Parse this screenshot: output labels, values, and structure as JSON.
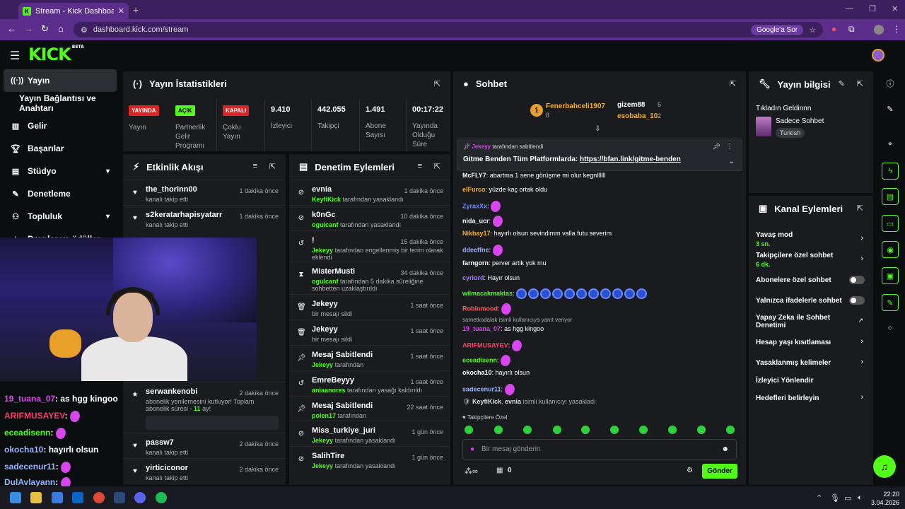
{
  "browser": {
    "tab_title": "Stream - Kick Dashboard",
    "url": "dashboard.kick.com/stream",
    "google_btn": "Google'a Sor"
  },
  "app": {
    "logo": "KICK",
    "logo_badge": "BETA"
  },
  "sidebar": {
    "items": [
      {
        "label": "Yayın",
        "icon": "broadcast-icon"
      },
      {
        "label": "Yayın Bağlantısı ve Anahtarı"
      },
      {
        "label": "Gelir",
        "icon": "chart-icon"
      },
      {
        "label": "Başarılar",
        "icon": "trophy-icon"
      },
      {
        "label": "Stüdyo",
        "icon": "studio-icon"
      },
      {
        "label": "Denetleme",
        "icon": "wrench-icon"
      },
      {
        "label": "Topluluk",
        "icon": "community-icon"
      },
      {
        "label": "Droplar ve ödüller",
        "icon": "gift-icon"
      }
    ]
  },
  "stats": {
    "title": "Yayın İstatistikleri",
    "cols": [
      {
        "badge": "YAYINDA",
        "label": "Yayın"
      },
      {
        "badge": "AÇIK",
        "label": "Partnerlik Gelir Programı"
      },
      {
        "badge": "KAPALI",
        "label": "Çoklu Yayın"
      },
      {
        "value": "9.410",
        "label": "İzleyici"
      },
      {
        "value": "442.055",
        "label": "Takipçi"
      },
      {
        "value": "1.491",
        "label": "Abone Sayısı"
      },
      {
        "value": "00:17:22",
        "label": "Yayında Olduğu Süre"
      }
    ]
  },
  "activity": {
    "title": "Etkinlik Akışı",
    "rows": [
      {
        "name": "the_thorinn00",
        "sub": "kanalı takip etti",
        "time": "1 dakika önce"
      },
      {
        "name": "s2keratarhapisyatarr",
        "sub": "kanalı takip etti",
        "time": "1 dakika önce"
      },
      {
        "name": "serwankenobi",
        "sub": "abonelik yenilemesini kutluyor! Toplam abonelik süresi - ",
        "months": "11",
        "sub2": " ay!",
        "time": "2 dakika önce"
      },
      {
        "name": "passw7",
        "sub": "kanalı takip etti",
        "time": "2 dakika önce"
      },
      {
        "name": "yirticiconor",
        "sub": "kanalı takip etti",
        "time": "2 dakika önce"
      }
    ]
  },
  "moderation": {
    "title": "Denetim Eylemleri",
    "rows": [
      {
        "name": "evnia",
        "actor": "KeyfiKick",
        "action": "tarafından yasaklandı",
        "time": "1 dakika önce"
      },
      {
        "name": "k0nGc",
        "actor": "ogulcanf",
        "action": "tarafından yasaklandı",
        "time": "10 dakika önce"
      },
      {
        "name": "!",
        "actor": "Jekeyy",
        "action": "tarafından engellenmiş bir terim olarak eklendi",
        "time": "15 dakika önce"
      },
      {
        "name": "MisterMusti",
        "actor": "ogulcanf",
        "action": "tarafından 5 dakika süreliğine sohbetten uzaklaştırıldı",
        "time": "34 dakika önce"
      },
      {
        "name": "Jekeyy",
        "actor": "",
        "action": "bir mesajı sildi",
        "time": "1 saat önce"
      },
      {
        "name": "Jekeyy",
        "actor": "",
        "action": "bir mesajı sildi",
        "time": "1 saat önce"
      },
      {
        "name": "Mesaj Sabitlendi",
        "actor": "Jekeyy",
        "action": "tarafından",
        "time": "1 saat önce"
      },
      {
        "name": "EmreBeyyy",
        "actor": "aniaanores",
        "action": "tarafından yasağı kaldırıldı",
        "time": "1 saat önce"
      },
      {
        "name": "Mesaj Sabitlendi",
        "actor": "polen17",
        "action": "tarafından",
        "time": "22 saat önce"
      },
      {
        "name": "Miss_turkiye_juri",
        "actor": "Jekeyy",
        "action": "tarafından yasaklandı",
        "time": "1 gün önce"
      },
      {
        "name": "SalihTire",
        "actor": "Jekeyy",
        "action": "tarafından yasaklandı",
        "time": "1 gün önce"
      }
    ]
  },
  "chat": {
    "title": "Sohbet",
    "leaderboard": [
      {
        "name": "Fenerbahceli1907",
        "count": "8"
      },
      {
        "name": "gizem88",
        "count": "5"
      },
      {
        "name": "esobaba_10",
        "count": "2"
      }
    ],
    "pinned_by": "Jekeyy",
    "pinned_label": "tarafından sabitlendi",
    "pinned_text": "Gitme Benden Tüm Platformlarda: ",
    "pinned_link": "https://bfan.link/gitme-benden",
    "messages": [
      {
        "user": "McFLY7",
        "color": "#ffffff",
        "text": "abartma 1 sene görüşme mi olur kegnllllll"
      },
      {
        "user": "elFurco",
        "color": "#f0b030",
        "text": "yüzde kaç ortak oldu"
      },
      {
        "user": "ZyraxXx",
        "color": "#6b8cff",
        "text": ""
      },
      {
        "user": "nida_ucr",
        "color": "#ffffff",
        "text": ""
      },
      {
        "user": "Nikbay17",
        "color": "#f0b030",
        "text": "hayırlı olsun sevindimm valla futu severim"
      },
      {
        "user": "ddeeffne",
        "color": "#9ab3ff",
        "text": ""
      },
      {
        "user": "farngorn",
        "color": "#ffffff",
        "text": "perver artik yok mu"
      },
      {
        "user": "cyriord",
        "color": "#a07cff",
        "text": "Hayır olsun"
      },
      {
        "user": "wilmacakmaktas",
        "color": "#53fc18",
        "text": ""
      },
      {
        "user": "Robinmood",
        "color": "#ff6060",
        "text": ""
      },
      {
        "user": "19_tuana_07",
        "color": "#d946ef",
        "text": "as hgg kingoo"
      },
      {
        "user": "ARIFMUSAYEV",
        "color": "#ff3b6b",
        "text": ""
      },
      {
        "user": "eceadisenn",
        "color": "#53fc18",
        "text": ""
      },
      {
        "user": "okocha10",
        "color": "#ffffff",
        "text": "hayırlı olsun"
      },
      {
        "user": "sadecenur11",
        "color": "#9ab3ff",
        "text": ""
      }
    ],
    "reply_note": "isimli kullanıcıya yanıt veriyor",
    "reply_user": "sametkodalak",
    "ban_note_actor": "KeyfiKick",
    "ban_note_target": "evnia",
    "ban_note_text": "isimli kullanıcıyı yasakladı",
    "follower_label": "Takipçilere Özel",
    "input_placeholder": "Bir mesaj gönderin",
    "points": "0",
    "send_label": "Gönder"
  },
  "stream_info": {
    "title": "Yayın bilgisi",
    "stream_title": "Tıkladın Geldinnn",
    "category": "Sadece Sohbet",
    "tag": "Turkish"
  },
  "channel_actions": {
    "title": "Kanal Eylemleri",
    "items": [
      {
        "label": "Yavaş mod",
        "sub": "3 sn."
      },
      {
        "label": "Takipçilere özel sohbet",
        "sub": "6 dk."
      },
      {
        "label": "Abonelere özel sohbet"
      },
      {
        "label": "Yalnızca ifadelerle sohbet"
      },
      {
        "label": "Yapay Zeka ile Sohbet Denetimi"
      },
      {
        "label": "Hesap yaşı kısıtlaması"
      },
      {
        "label": "Yasaklanmış kelimeler"
      },
      {
        "label": "İzleyici Yönlendir"
      },
      {
        "label": "Hedefleri belirleyin"
      }
    ]
  },
  "overlay_chat": [
    {
      "user": "19_tuana_07",
      "color": "#d946ef",
      "text": ": as hgg kingoo"
    },
    {
      "user": "ARIFMUSAYEV",
      "color": "#ff3b6b",
      "text": ":"
    },
    {
      "user": "eceadisenn",
      "color": "#53fc18",
      "text": ":"
    },
    {
      "user": "okocha10",
      "color": "#9ab3ff",
      "text": ": hayırlı olsun"
    },
    {
      "user": "sadecenur11",
      "color": "#9ab3ff",
      "text": ":"
    },
    {
      "user": "DulAvlayann",
      "color": "#9ab3ff",
      "text": ":"
    }
  ],
  "taskbar": {
    "time": "22:20",
    "date": "3.04.2026"
  }
}
